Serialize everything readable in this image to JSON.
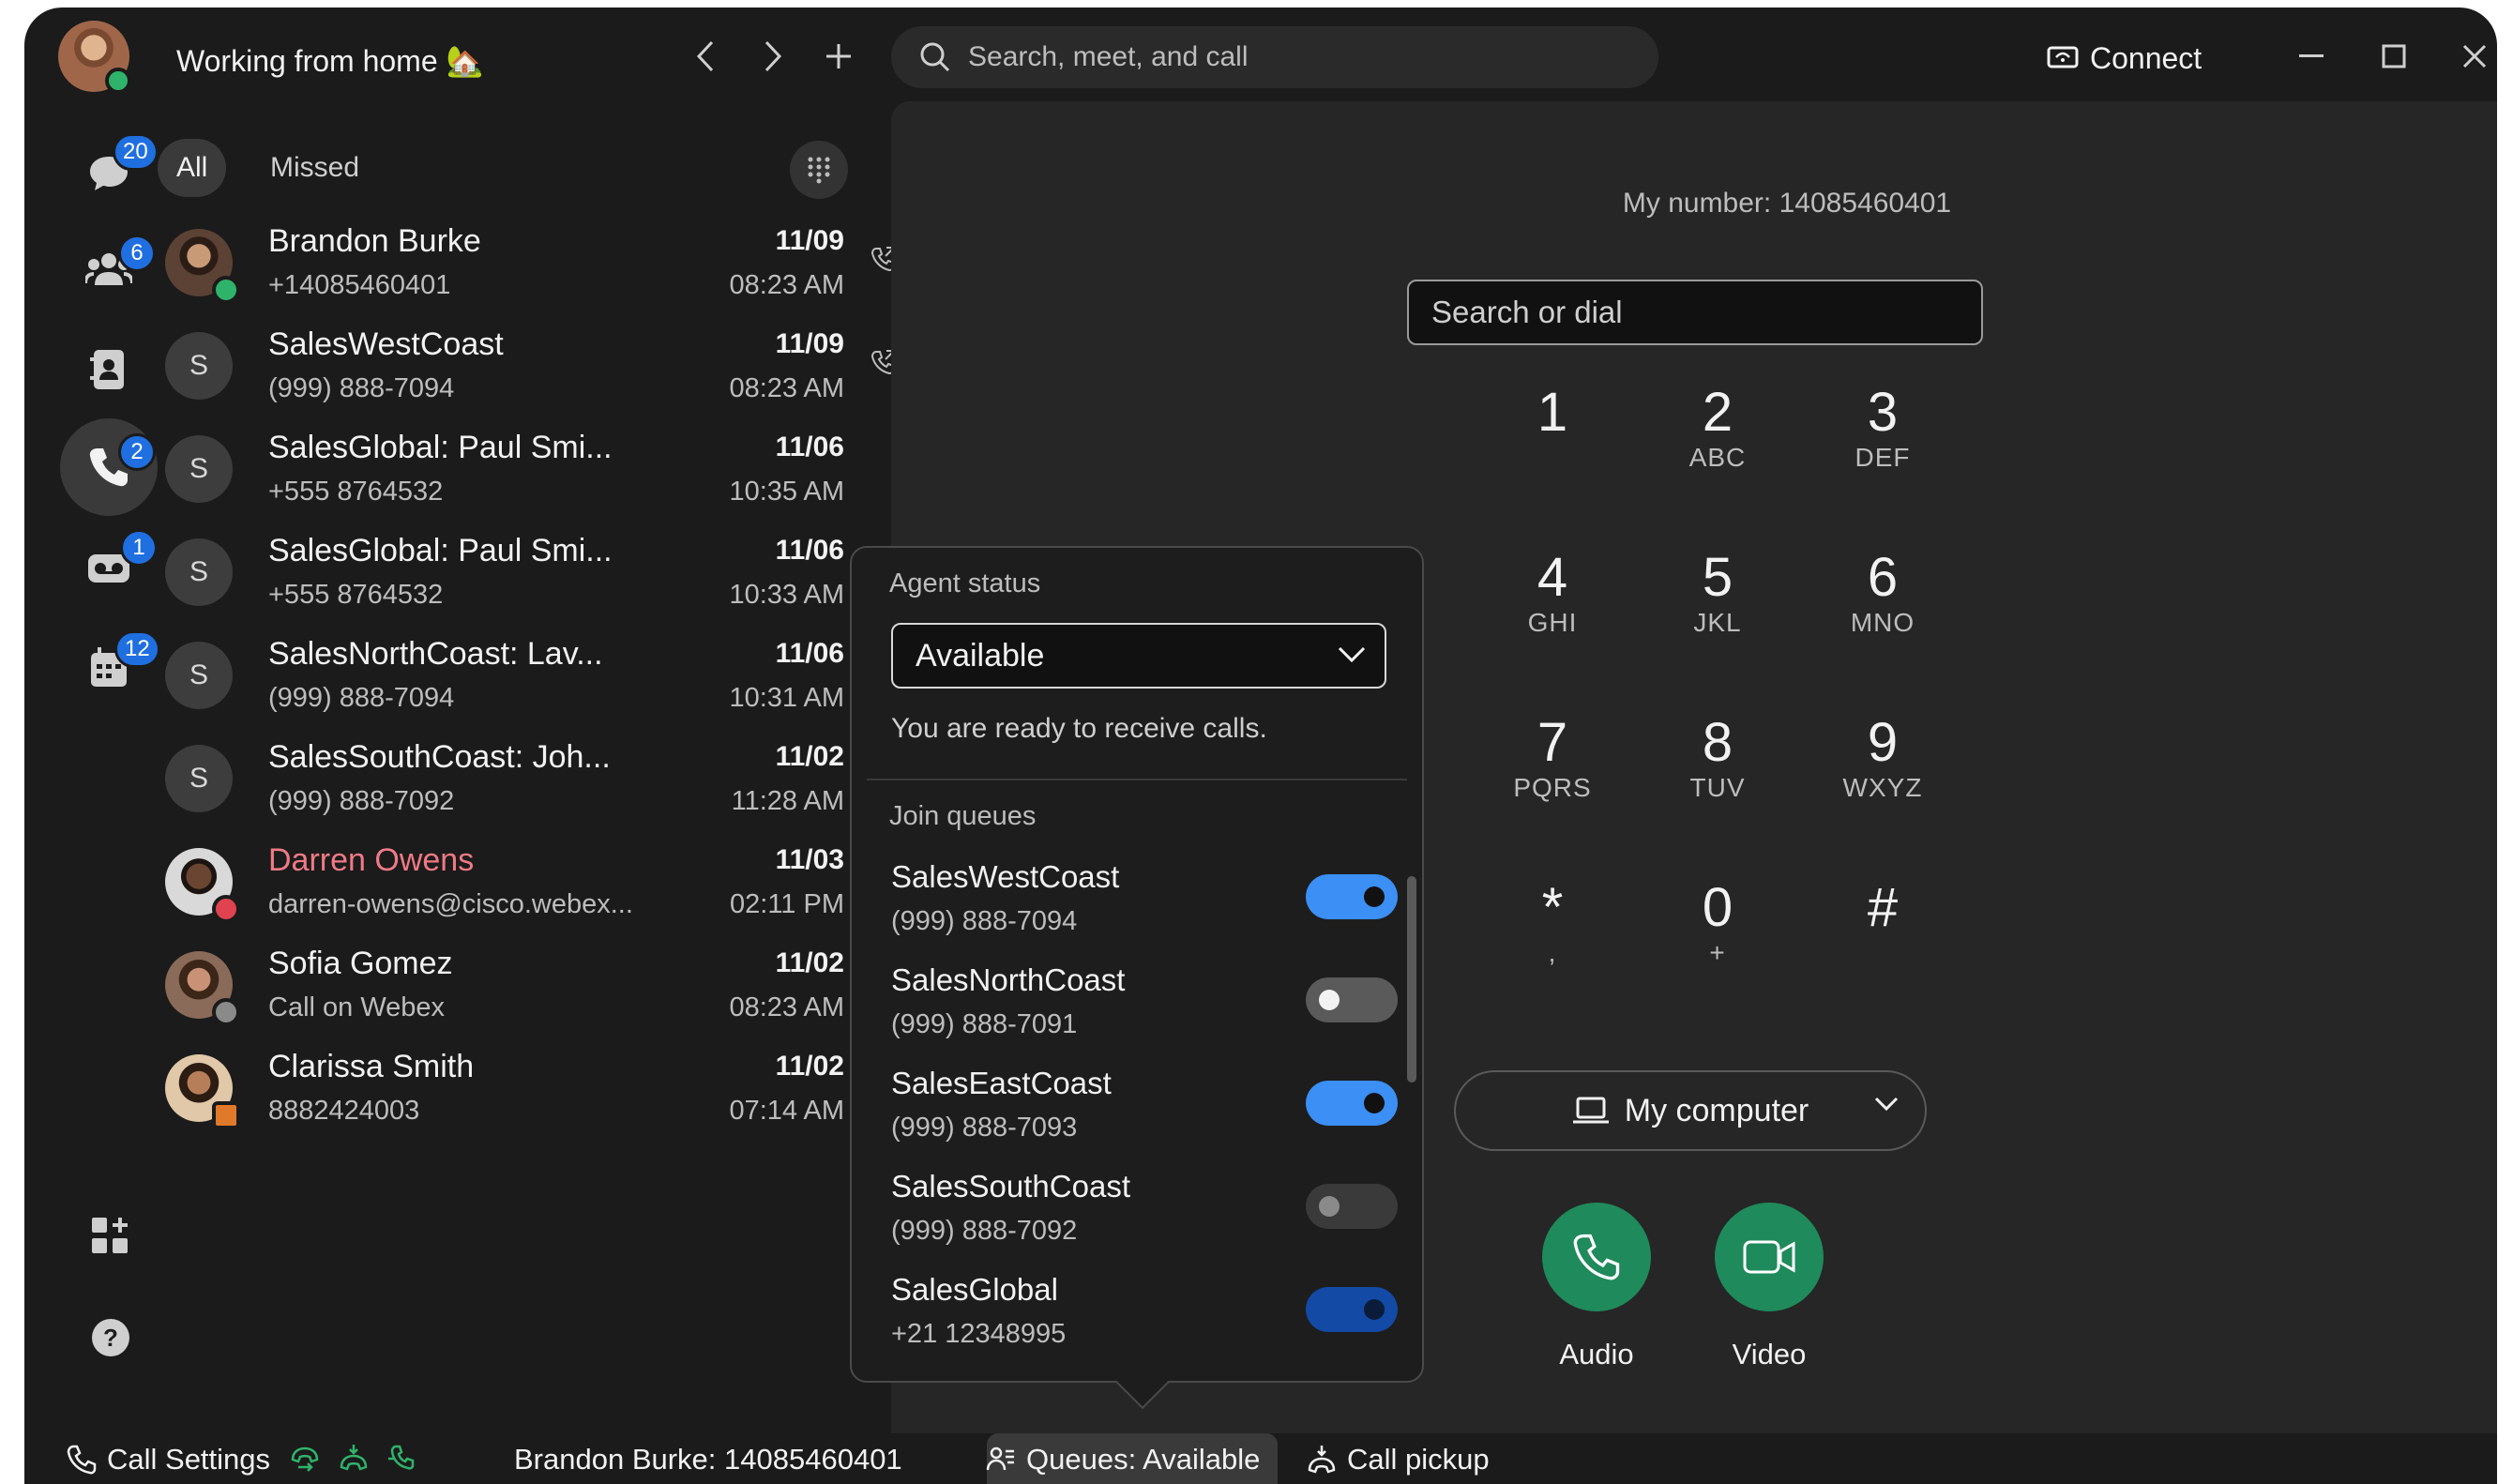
{
  "window": {
    "status_text": "Working from home 🏡",
    "search_placeholder": "Search, meet, and call",
    "connect_label": "Connect"
  },
  "rail": {
    "messages_badge": "20",
    "teams_badge": "6",
    "calls_badge": "2",
    "voicemail_badge": "1",
    "meetings_badge": "12"
  },
  "filters": {
    "all": "All",
    "missed": "Missed"
  },
  "calls": [
    {
      "initial": "",
      "name": "Brandon Burke",
      "sub": "+14085460401",
      "date": "11/09",
      "time": "08:23 AM"
    },
    {
      "initial": "S",
      "name": "SalesWestCoast",
      "sub": "(999) 888-7094",
      "date": "11/09",
      "time": "08:23 AM"
    },
    {
      "initial": "S",
      "name": "SalesGlobal: Paul Smi...",
      "sub": "+555 8764532",
      "date": "11/06",
      "time": "10:35 AM"
    },
    {
      "initial": "S",
      "name": "SalesGlobal: Paul Smi...",
      "sub": "+555 8764532",
      "date": "11/06",
      "time": "10:33 AM"
    },
    {
      "initial": "S",
      "name": "SalesNorthCoast: Lav...",
      "sub": "(999) 888-7094",
      "date": "11/06",
      "time": "10:31 AM"
    },
    {
      "initial": "S",
      "name": "SalesSouthCoast: Joh...",
      "sub": "(999) 888-7092",
      "date": "11/02",
      "time": "11:28 AM"
    },
    {
      "initial": "",
      "name": "Darren Owens",
      "sub": "darren-owens@cisco.webex...",
      "date": "11/03",
      "time": "02:11 PM"
    },
    {
      "initial": "",
      "name": "Sofia Gomez",
      "sub": "Call on Webex",
      "date": "11/02",
      "time": "08:23 AM"
    },
    {
      "initial": "",
      "name": "Clarissa Smith",
      "sub": "8882424003",
      "date": "11/02",
      "time": "07:14 AM"
    }
  ],
  "dialpad": {
    "my_number": "My number: 14085460401",
    "input_placeholder": "Search or dial",
    "keys": [
      {
        "d": "1",
        "l": ""
      },
      {
        "d": "2",
        "l": "ABC"
      },
      {
        "d": "3",
        "l": "DEF"
      },
      {
        "d": "4",
        "l": "GHI"
      },
      {
        "d": "5",
        "l": "JKL"
      },
      {
        "d": "6",
        "l": "MNO"
      },
      {
        "d": "7",
        "l": "PQRS"
      },
      {
        "d": "8",
        "l": "TUV"
      },
      {
        "d": "9",
        "l": "WXYZ"
      },
      {
        "d": "*",
        "l": ","
      },
      {
        "d": "0",
        "l": "+"
      },
      {
        "d": "#",
        "l": ""
      }
    ],
    "device": "My computer",
    "audio_label": "Audio",
    "video_label": "Video"
  },
  "agent_popup": {
    "header": "Agent status",
    "status_value": "Available",
    "status_message": "You are ready to receive calls.",
    "queues_header": "Join queues",
    "queues": [
      {
        "name": "SalesWestCoast",
        "phone": "(999) 888-7094",
        "on": true
      },
      {
        "name": "SalesNorthCoast",
        "phone": "(999) 888-7091",
        "on": false
      },
      {
        "name": "SalesEastCoast",
        "phone": "(999) 888-7093",
        "on": true
      },
      {
        "name": "SalesSouthCoast",
        "phone": "(999) 888-7092",
        "on": false
      },
      {
        "name": "SalesGlobal",
        "phone": "+21 12348995",
        "on": true
      }
    ]
  },
  "bottom_bar": {
    "call_settings": "Call Settings",
    "line": "Brandon Burke: 14085460401",
    "queues": "Queues: Available",
    "call_pickup": "Call pickup"
  },
  "colors": {
    "background": "#1b1b1b",
    "panel": "#262626",
    "accent_blue": "#3b8ff5",
    "call_green": "#1f8a5b",
    "badge_blue": "#1f6fe0",
    "missed_red": "#f07a86",
    "presence_green": "#2fb36b"
  }
}
